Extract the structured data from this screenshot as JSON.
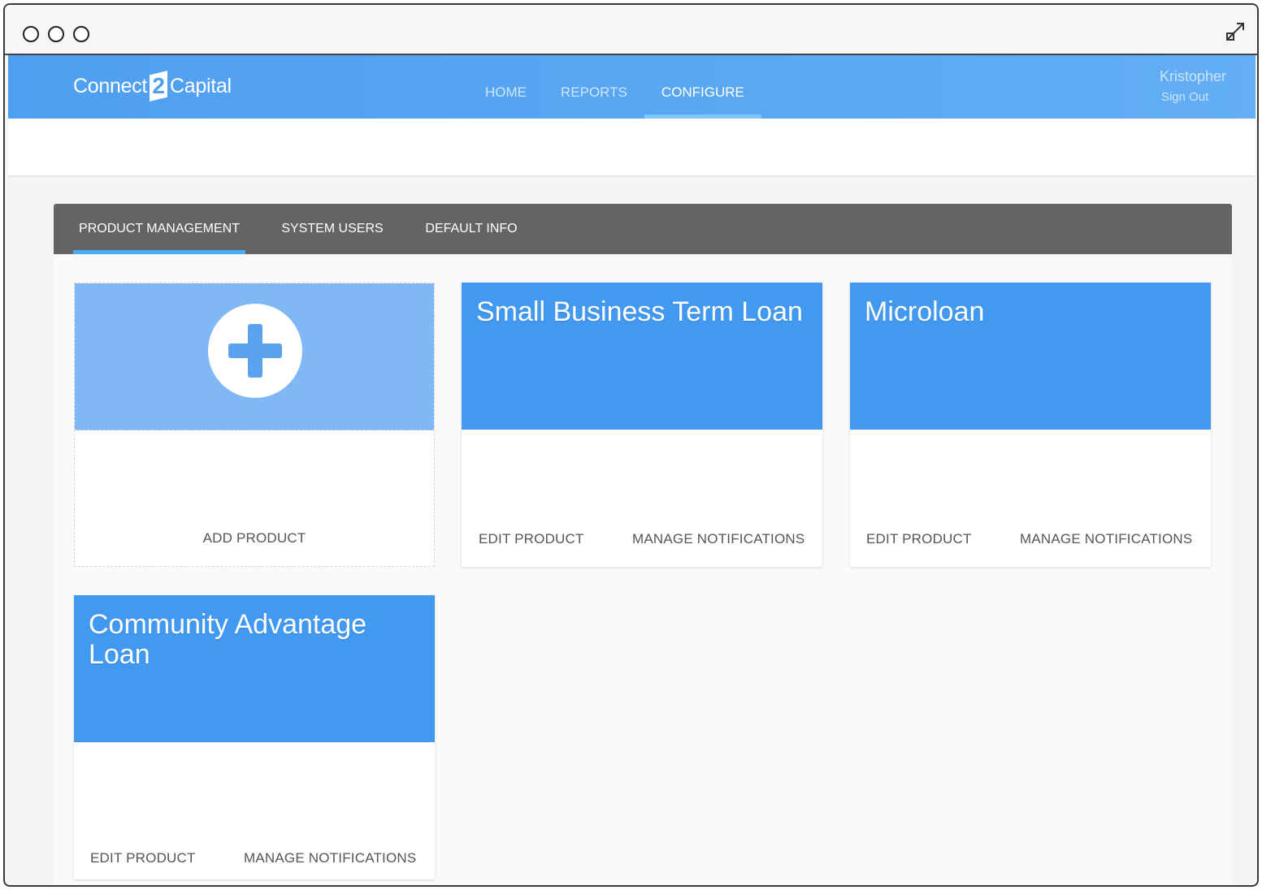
{
  "colors": {
    "appbar": "#4f9ff0",
    "card_header": "#4299f0",
    "add_card_header": "#7fb8f5",
    "tabbar": "#646464",
    "tab_indicator": "#4aa9f6"
  },
  "icons": {
    "expand": "expand-icon",
    "add": "plus-icon"
  },
  "logo": {
    "left": "Connect",
    "mark": "2",
    "right": "Capital"
  },
  "nav": {
    "items": [
      {
        "label": "HOME",
        "active": false
      },
      {
        "label": "REPORTS",
        "active": false
      },
      {
        "label": "CONFIGURE",
        "active": true
      }
    ]
  },
  "user": {
    "name": "Kristopher",
    "signout": "Sign Out"
  },
  "tabs": {
    "items": [
      {
        "label": "PRODUCT MANAGEMENT",
        "active": true
      },
      {
        "label": "SYSTEM USERS",
        "active": false
      },
      {
        "label": "DEFAULT INFO",
        "active": false
      }
    ]
  },
  "add_card": {
    "label": "ADD PRODUCT"
  },
  "products": [
    {
      "title": "Small Business Term Loan",
      "edit": "EDIT PRODUCT",
      "notify": "MANAGE NOTIFICATIONS"
    },
    {
      "title": "Microloan",
      "edit": "EDIT PRODUCT",
      "notify": "MANAGE NOTIFICATIONS"
    },
    {
      "title": "Community Advantage Loan",
      "edit": "EDIT PRODUCT",
      "notify": "MANAGE NOTIFICATIONS"
    }
  ]
}
